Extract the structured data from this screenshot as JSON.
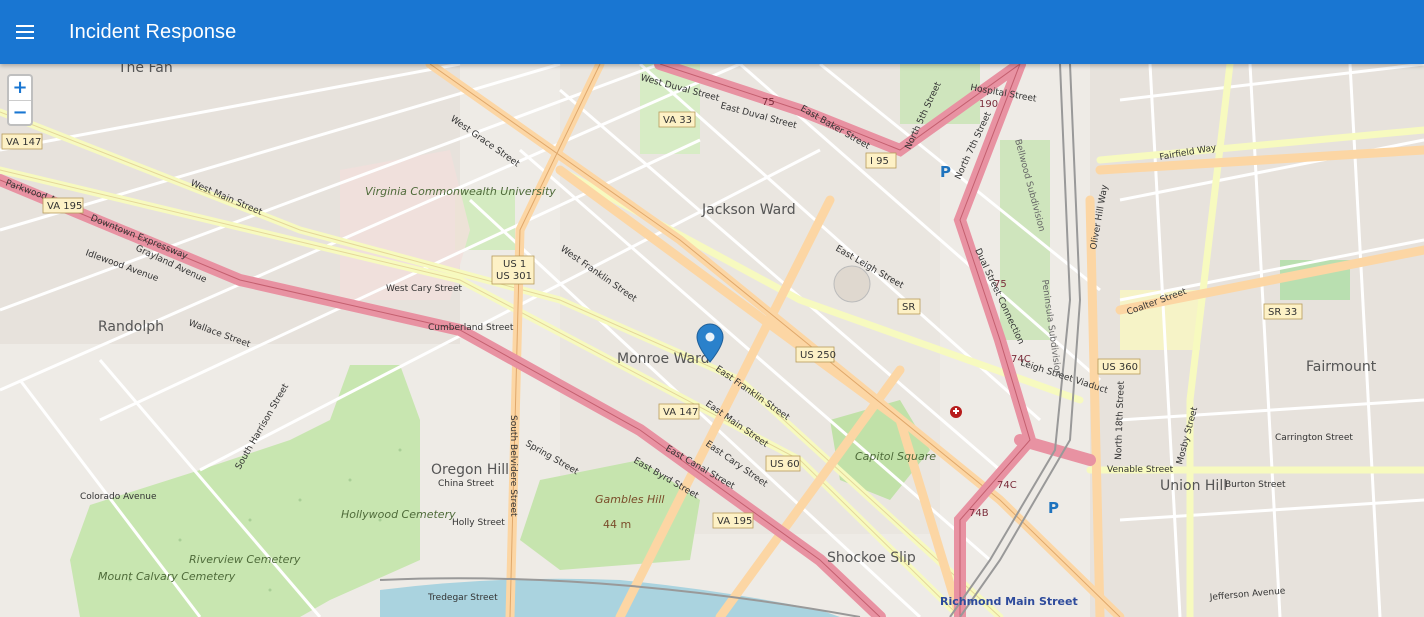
{
  "app": {
    "title": "Incident Response"
  },
  "map": {
    "zoom_in": "+",
    "zoom_out": "−",
    "neighborhoods": [
      {
        "name": "Jackson Ward"
      },
      {
        "name": "Monroe Ward"
      },
      {
        "name": "Randolph"
      },
      {
        "name": "Oregon Hill"
      },
      {
        "name": "Fairmount"
      },
      {
        "name": "Union Hill"
      },
      {
        "name": "Shockoe Slip"
      },
      {
        "name": "The Fan"
      }
    ],
    "places": [
      "Virginia Commonwealth University",
      "Hollywood Cemetery",
      "Riverview Cemetery",
      "Mount Calvary Cemetery",
      "Capitol Square",
      "Gambles Hill",
      "44 m",
      "Richmond Main Street"
    ],
    "streets": [
      "West Main Street",
      "West Cary Street",
      "Downtown Expressway",
      "West Franklin Street",
      "West Grace Street",
      "East Leigh Street",
      "Leigh Street Viaduct",
      "East Main Street",
      "East Cary Street",
      "East Franklin Street",
      "Cumberland Street",
      "South Belvidere Street",
      "Oliver Hill Way",
      "North 18th Street",
      "Venable Street",
      "Fairfield Way",
      "Mosby Street",
      "Colorado Avenue",
      "Spring Street",
      "China Street",
      "Holly Street",
      "Tredegar Street",
      "East Canal Street",
      "East Byrd Street",
      "Hospital Street",
      "East Baker Street",
      "West Duval Street",
      "East Duval Street",
      "Jefferson Avenue",
      "Carrington Street",
      "Burton Street",
      "Coalter Street",
      "Wallace Street",
      "Grayland Avenue",
      "Parkwood Avenue",
      "Idlewood Avenue",
      "South Harrison Street",
      "North 7th Street",
      "North 5th Street",
      "Bellwood Subdivision",
      "Peninsula Subdivision",
      "Dual Street Connection"
    ],
    "shields": [
      "US 250",
      "VA 147",
      "VA 195",
      "VA 33",
      "US 1",
      "US 301",
      "I 95",
      "SR",
      "US 60",
      "US 360",
      "SR 33",
      "75",
      "74C",
      "74B",
      "190"
    ],
    "marker": {
      "label": "incident-location"
    }
  }
}
